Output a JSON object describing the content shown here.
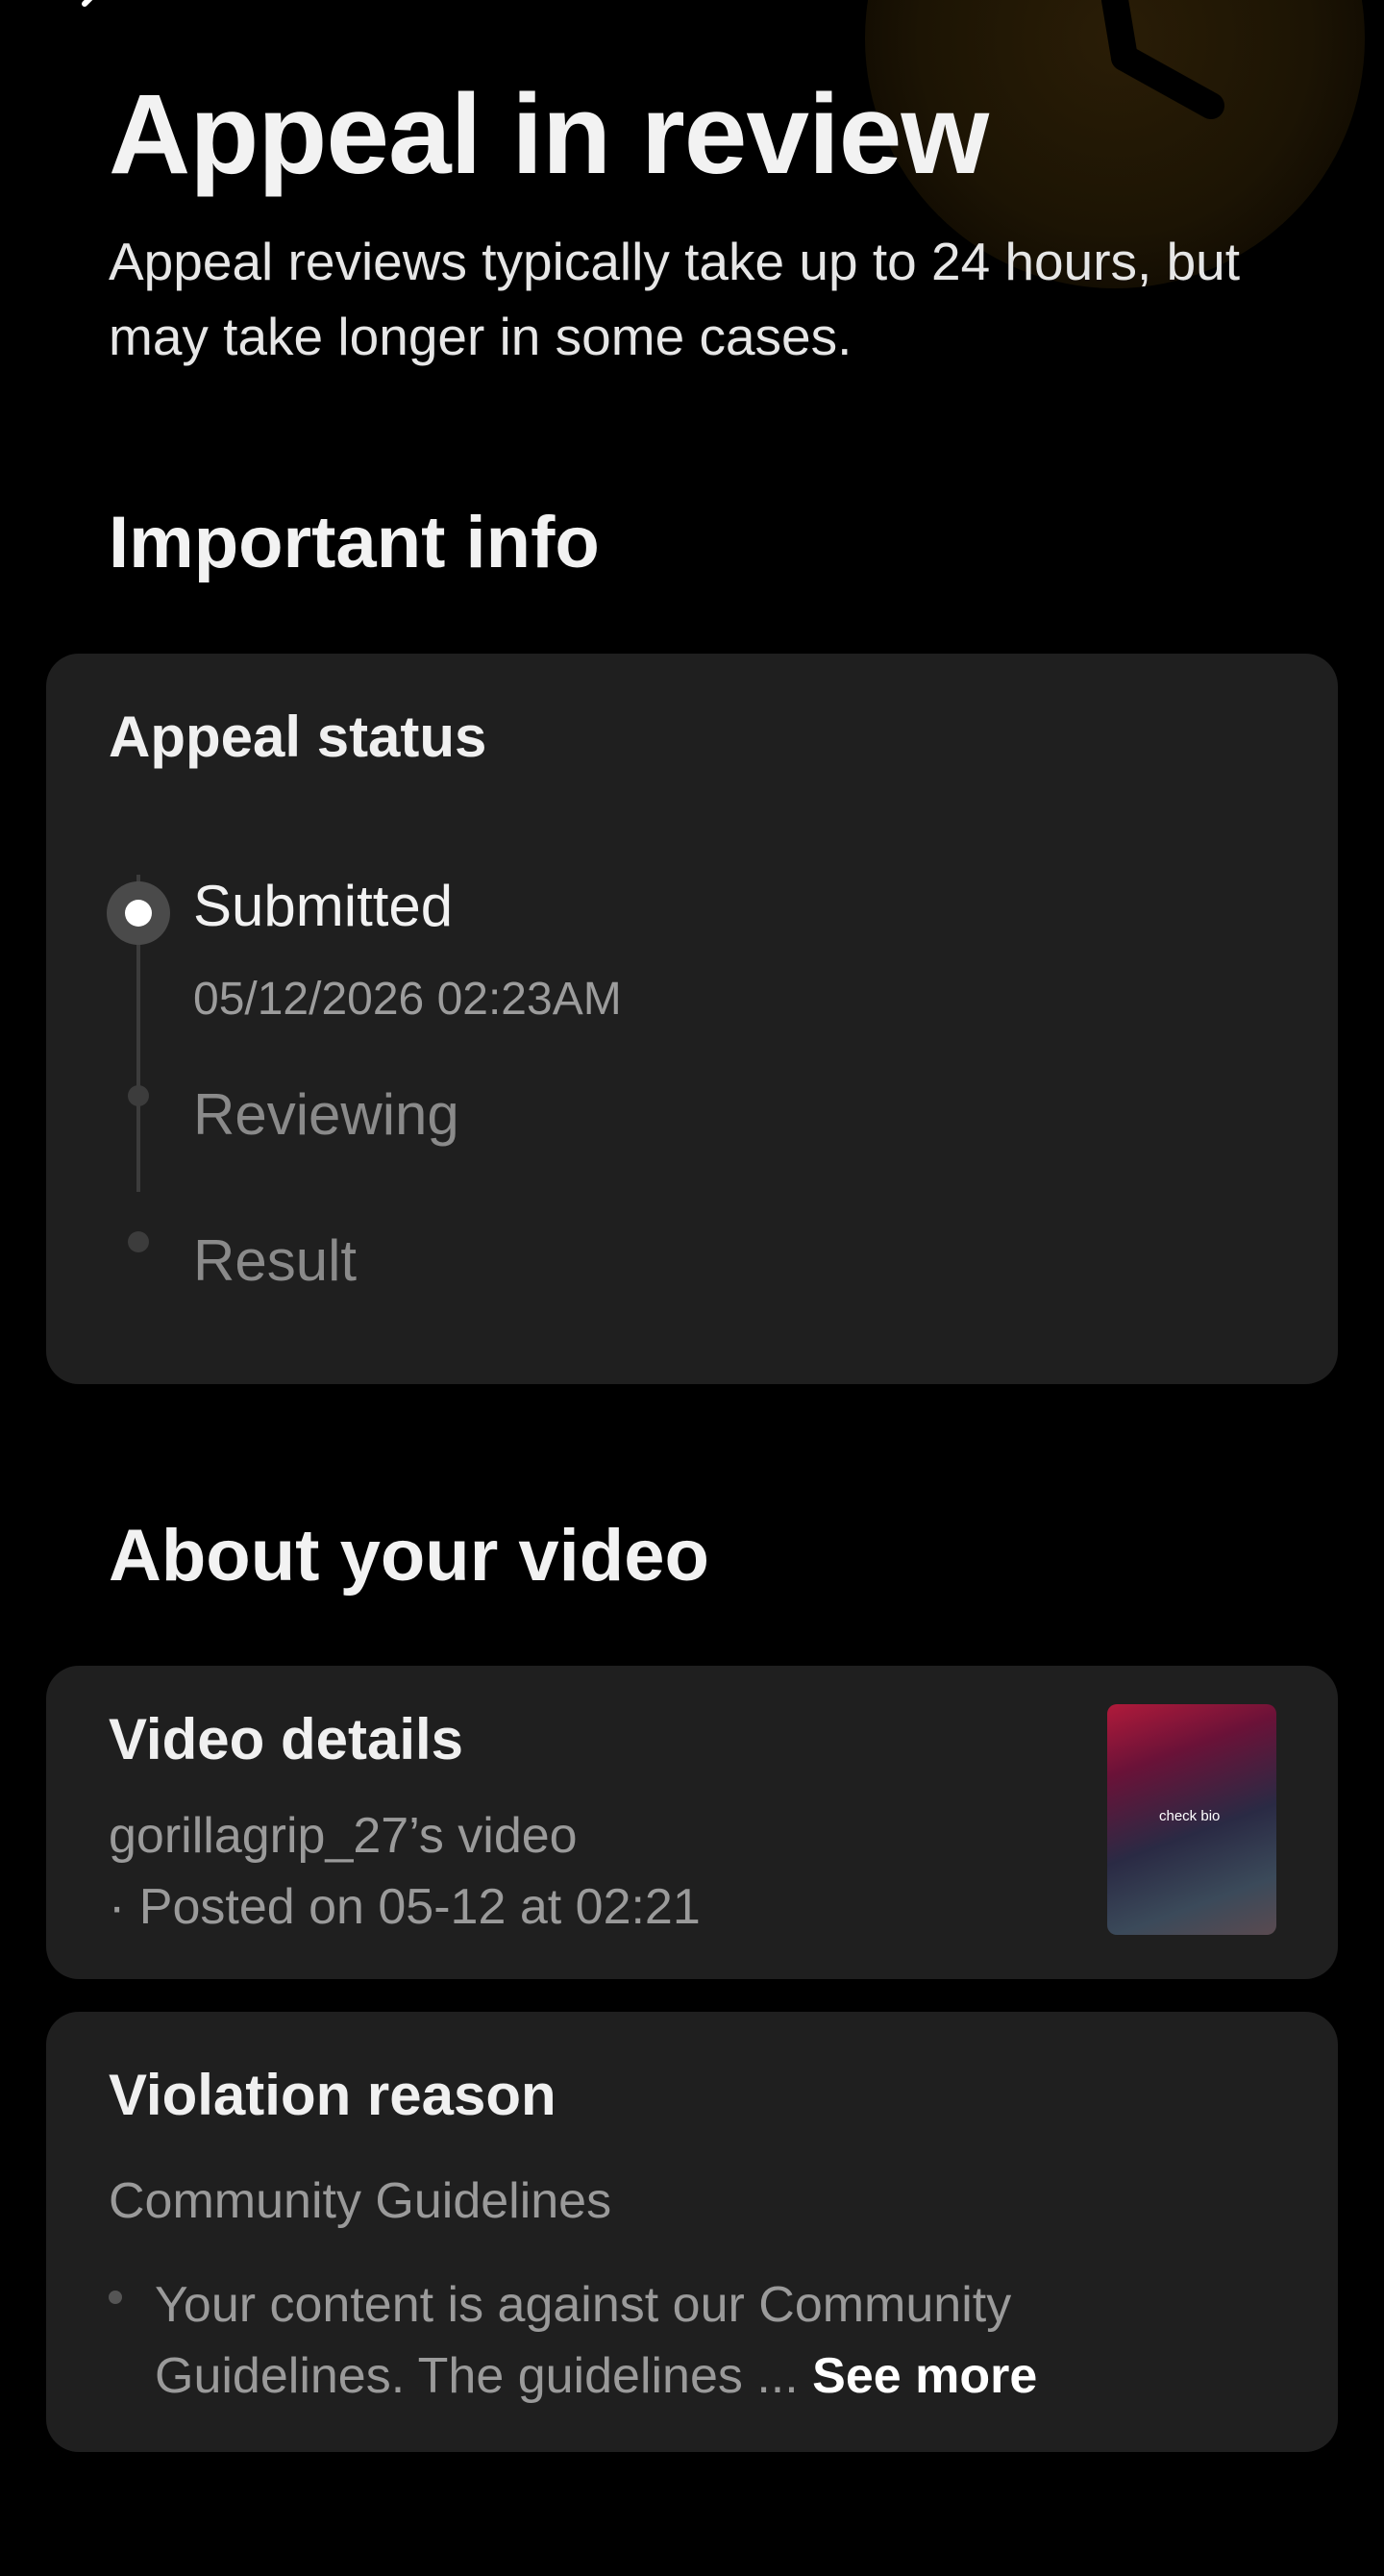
{
  "header": {
    "back_icon": "back-chevron-icon",
    "title": "Appeal in review",
    "subtitle": "Appeal reviews typically take up to 24 hours, but may take longer in some cases.",
    "decoration_icon": "clock-icon"
  },
  "important_info": {
    "heading": "Important info",
    "appeal_status": {
      "title": "Appeal status",
      "steps": [
        {
          "label": "Submitted",
          "time": "05/12/2026 02:23AM",
          "state": "active"
        },
        {
          "label": "Reviewing",
          "state": "pending"
        },
        {
          "label": "Result",
          "state": "pending"
        }
      ]
    }
  },
  "about_video": {
    "heading": "About your video",
    "video_details": {
      "title": "Video details",
      "owner": "gorillagrip_27’s video",
      "posted": "· Posted on 05-12 at 02:21",
      "thumbnail_caption": "check bio"
    },
    "violation": {
      "title": "Violation reason",
      "category": "Community Guidelines",
      "description": "Your content is against our Community Guidelines. The guidelines ...",
      "see_more": "See more"
    }
  },
  "colors": {
    "background": "#000000",
    "card": "#1f1f1f",
    "muted_text": "#9a9a9a",
    "accent_glow": "#2a1d06"
  }
}
